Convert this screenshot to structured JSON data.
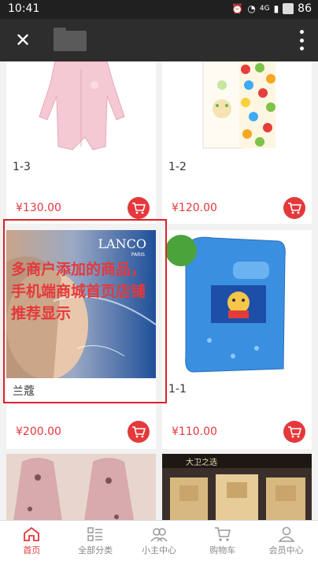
{
  "status_bar": {
    "time": "10:41",
    "signal": "4G",
    "battery": "86"
  },
  "products": [
    {
      "name": "1-3",
      "price": "¥130.00"
    },
    {
      "name": "1-2",
      "price": "¥120.00"
    },
    {
      "name": "兰蔻",
      "price": "¥200.00",
      "brand": "LANCO",
      "brand_sub": "PARIS"
    },
    {
      "name": "1-1",
      "price": "¥110.00"
    },
    {
      "name": "",
      "price": ""
    },
    {
      "name": "",
      "price": "",
      "brand": "大卫之选"
    }
  ],
  "annotation": {
    "line1": "多商户添加的商品，",
    "line2": "手机端商城首页店铺",
    "line3": "推荐显示"
  },
  "nav": [
    {
      "label": "首页",
      "icon": "home-icon",
      "active": true
    },
    {
      "label": "全部分类",
      "icon": "category-icon"
    },
    {
      "label": "小主中心",
      "icon": "people-icon"
    },
    {
      "label": "购物车",
      "icon": "cart-icon"
    },
    {
      "label": "会员中心",
      "icon": "user-icon"
    }
  ],
  "colors": {
    "accent": "#e4393c",
    "header": "#2d2d2d"
  }
}
